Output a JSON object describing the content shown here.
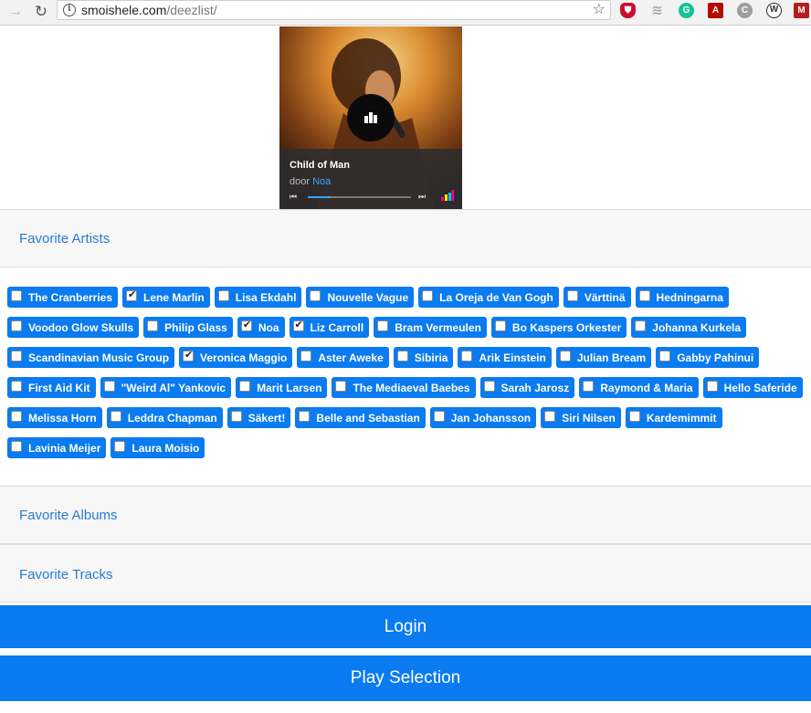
{
  "browser": {
    "url_host": "smoishele.com",
    "url_path": "/deezlist/",
    "icons": [
      "forward-icon",
      "reload-icon",
      "info-icon",
      "star-icon"
    ],
    "extensions": [
      "ublock-icon",
      "layers-icon",
      "grammarly-icon",
      "acrobat-icon",
      "c-extension-icon",
      "w-extension-icon",
      "mega-icon"
    ]
  },
  "player": {
    "track_title": "Child of Man",
    "by_label": "door",
    "artist": "Noa",
    "progress": 0.22,
    "accent": "#3aa3ff"
  },
  "sections": {
    "artists_title": "Favorite Artists",
    "albums_title": "Favorite Albums",
    "tracks_title": "Favorite Tracks"
  },
  "artists": [
    {
      "name": "The Cranberries",
      "checked": false
    },
    {
      "name": "Lene Marlin",
      "checked": true
    },
    {
      "name": "Lisa Ekdahl",
      "checked": false
    },
    {
      "name": "Nouvelle Vague",
      "checked": false
    },
    {
      "name": "La Oreja de Van Gogh",
      "checked": false
    },
    {
      "name": "Värttinä",
      "checked": false
    },
    {
      "name": "Hedningarna",
      "checked": false
    },
    {
      "name": "Voodoo Glow Skulls",
      "checked": false
    },
    {
      "name": "Philip Glass",
      "checked": false
    },
    {
      "name": "Noa",
      "checked": true
    },
    {
      "name": "Liz Carroll",
      "checked": true
    },
    {
      "name": "Bram Vermeulen",
      "checked": false
    },
    {
      "name": "Bo Kaspers Orkester",
      "checked": false
    },
    {
      "name": "Johanna Kurkela",
      "checked": false
    },
    {
      "name": "Scandinavian Music Group",
      "checked": false
    },
    {
      "name": "Veronica Maggio",
      "checked": true
    },
    {
      "name": "Aster Aweke",
      "checked": false
    },
    {
      "name": "Sibiria",
      "checked": false
    },
    {
      "name": "Arik Einstein",
      "checked": false
    },
    {
      "name": "Julian Bream",
      "checked": false
    },
    {
      "name": "Gabby Pahinui",
      "checked": false
    },
    {
      "name": "First Aid Kit",
      "checked": false
    },
    {
      "name": "\"Weird Al\" Yankovic",
      "checked": false
    },
    {
      "name": "Marit Larsen",
      "checked": false
    },
    {
      "name": "The Mediaeval Baebes",
      "checked": false
    },
    {
      "name": "Sarah Jarosz",
      "checked": false
    },
    {
      "name": "Raymond & Maria",
      "checked": false
    },
    {
      "name": "Hello Saferide",
      "checked": false
    },
    {
      "name": "Melissa Horn",
      "checked": false
    },
    {
      "name": "Leddra Chapman",
      "checked": false
    },
    {
      "name": "Säkert!",
      "checked": false
    },
    {
      "name": "Belle and Sebastian",
      "checked": false
    },
    {
      "name": "Jan Johansson",
      "checked": false
    },
    {
      "name": "Siri Nilsen",
      "checked": false
    },
    {
      "name": "Kardemimmit",
      "checked": false
    },
    {
      "name": "Lavinia Meijer",
      "checked": false
    },
    {
      "name": "Laura Moisio",
      "checked": false
    }
  ],
  "buttons": {
    "login": "Login",
    "play": "Play Selection"
  },
  "colors": {
    "primary": "#0a7bf0",
    "section_title": "#2a7ad1",
    "section_bg": "#f7f7f7"
  }
}
